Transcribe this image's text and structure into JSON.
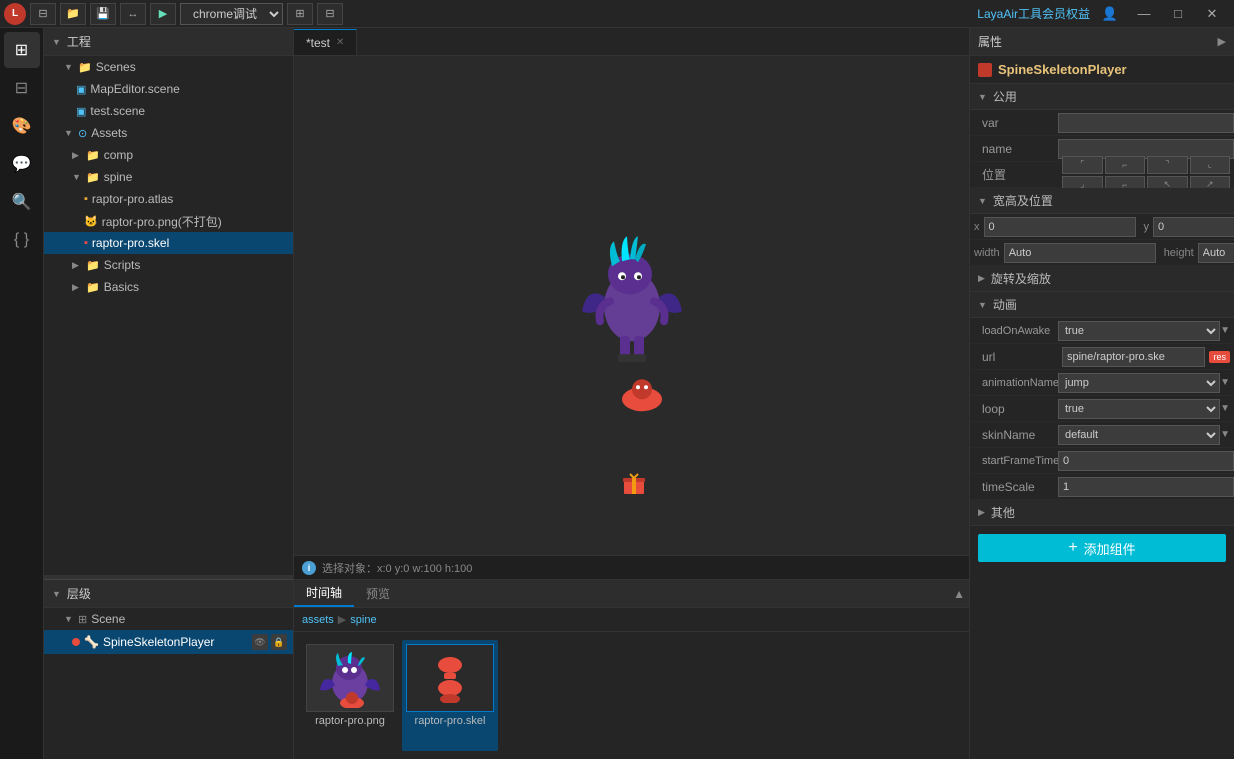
{
  "titlebar": {
    "logo_text": "L",
    "btns": [
      "⊟",
      "📁",
      "💾",
      "↔",
      "▶"
    ],
    "dropdown_label": "chrome调试",
    "laya_link": "LayaAir工具会员权益",
    "win_min": "—",
    "win_max": "□",
    "win_close": "✕"
  },
  "left_panel": {
    "project_label": "工程",
    "scenes_label": "Scenes",
    "scene_files": [
      "MapEditor.scene",
      "test.scene"
    ],
    "assets_label": "Assets",
    "comp_label": "comp",
    "spine_label": "spine",
    "spine_files": [
      {
        "name": "raptor-pro.atlas",
        "type": "atlas"
      },
      {
        "name": "raptor-pro.png(不打包)",
        "type": "png"
      },
      {
        "name": "raptor-pro.skel",
        "type": "skel",
        "selected": true
      }
    ],
    "scripts_label": "Scripts",
    "basics_label": "Basics"
  },
  "hierarchy": {
    "label": "层级",
    "scene_label": "Scene",
    "items": [
      {
        "name": "SpineSkeletonPlayer",
        "indent": 2,
        "selected": true,
        "has_dot": true
      }
    ]
  },
  "tabs": [
    {
      "label": "*test",
      "active": true,
      "closable": true
    }
  ],
  "viewport": {
    "status_text": "选择对象：x:0 y:0  w:100 h:100"
  },
  "bottom_panel": {
    "tabs": [
      "时间轴",
      "预览"
    ],
    "active_tab": "时间轴",
    "breadcrumb": [
      "assets",
      "spine"
    ],
    "assets": [
      {
        "name": "raptor-pro.png",
        "type": "png"
      },
      {
        "name": "raptor-pro.skel",
        "type": "skel",
        "selected": true
      }
    ]
  },
  "properties": {
    "header_label": "属性",
    "component_name": "SpineSkeletonPlayer",
    "sections": {
      "common": {
        "label": "公用",
        "fields": [
          {
            "key": "var",
            "label": "var",
            "value": ""
          },
          {
            "key": "name",
            "label": "name",
            "value": ""
          }
        ]
      },
      "position_label": "位置",
      "size_pos": {
        "label": "宽高及位置",
        "x_label": "x",
        "x_value": "0",
        "y_label": "y",
        "y_value": "0",
        "width_label": "width",
        "width_value": "Auto",
        "height_label": "height",
        "height_value": "Auto"
      },
      "rotation": {
        "label": "旋转及缩放"
      },
      "animation": {
        "label": "动画",
        "fields": [
          {
            "key": "loadOnAwake",
            "label": "loadOnAwake",
            "value": "true",
            "type": "select"
          },
          {
            "key": "url",
            "label": "url",
            "value": "spine/raptor-pro.ske",
            "type": "url"
          },
          {
            "key": "animationName",
            "label": "animationName",
            "value": "jump",
            "type": "select"
          },
          {
            "key": "loop",
            "label": "loop",
            "value": "true",
            "type": "select"
          },
          {
            "key": "skinName",
            "label": "skinName",
            "value": "default",
            "type": "select"
          },
          {
            "key": "startFrameTime",
            "label": "startFrameTime",
            "value": "0"
          },
          {
            "key": "timeScale",
            "label": "timeScale",
            "value": "1"
          }
        ]
      },
      "other": {
        "label": "其他"
      }
    },
    "add_component_label": "添加组件"
  }
}
